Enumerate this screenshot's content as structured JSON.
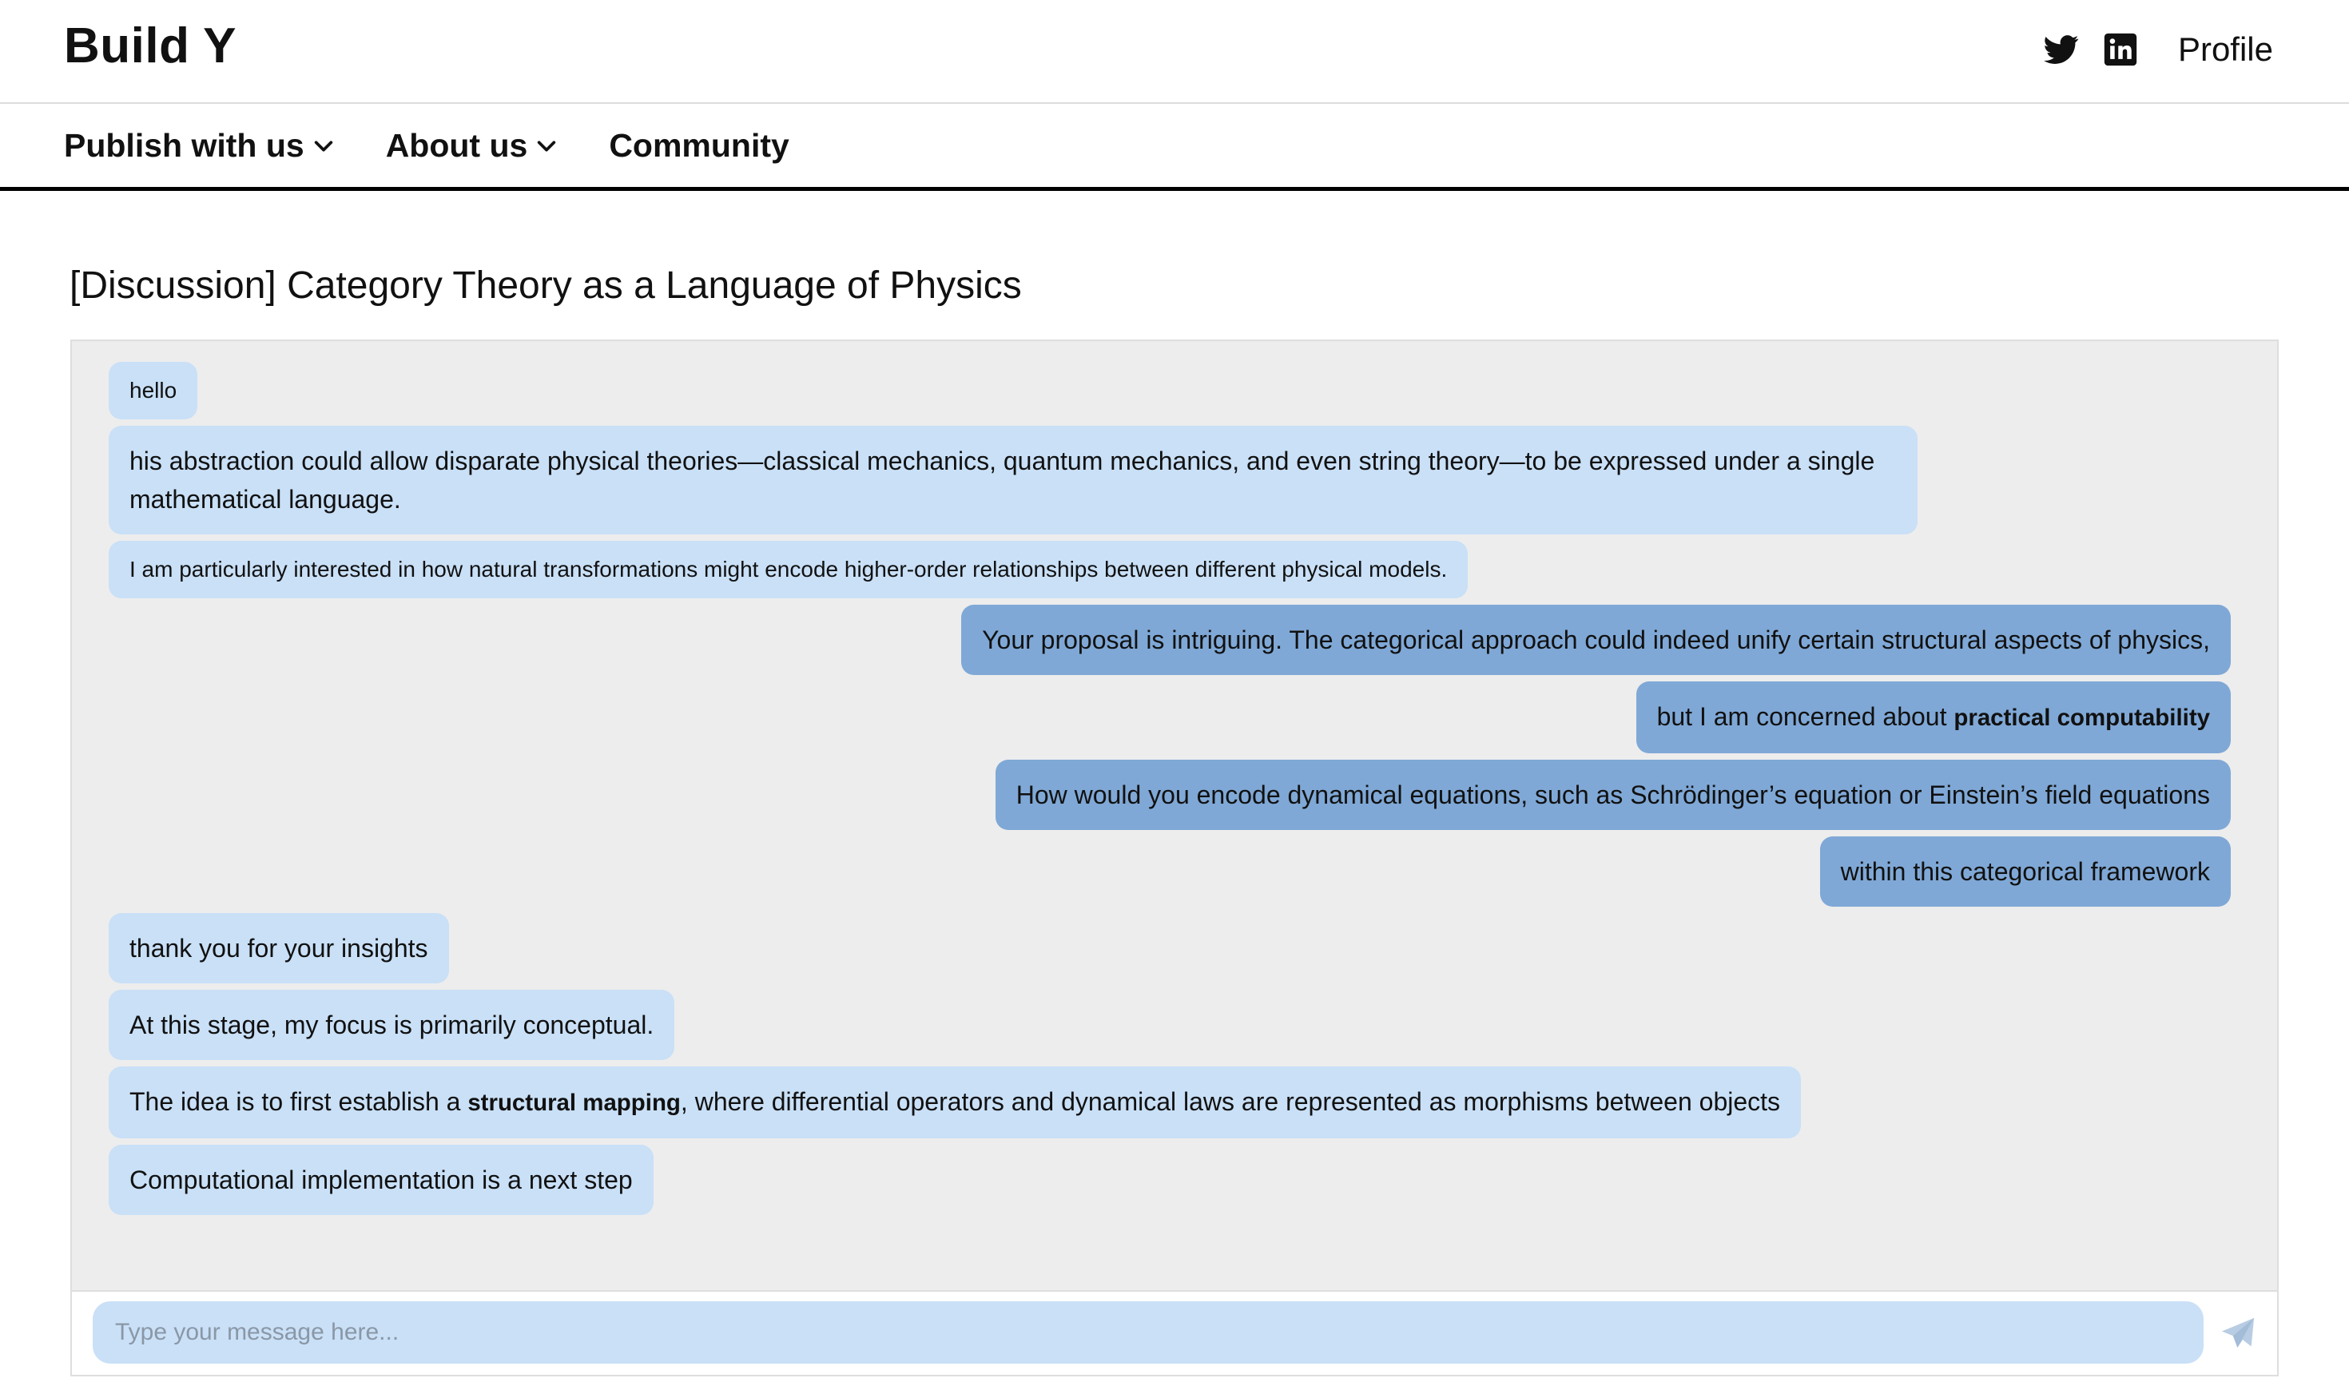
{
  "header": {
    "brand": "Build Y",
    "profile_label": "Profile",
    "icons": [
      "twitter-icon",
      "linkedin-icon"
    ]
  },
  "nav": {
    "items": [
      {
        "label": "Publish with us",
        "has_dropdown": true
      },
      {
        "label": "About us",
        "has_dropdown": true
      },
      {
        "label": "Community",
        "has_dropdown": false
      }
    ]
  },
  "page": {
    "title": "[Discussion] Category Theory as a Language of Physics"
  },
  "chat": {
    "messages": [
      {
        "side": "in",
        "text": "hello"
      },
      {
        "side": "in",
        "text": "his abstraction could allow disparate physical theories—classical mechanics, quantum mechanics, and even string theory—to be expressed under a single mathematical language."
      },
      {
        "side": "in",
        "text": "I am particularly interested in how natural transformations might encode higher-order relationships between different physical models."
      },
      {
        "side": "out",
        "text": "Your proposal is intriguing. The categorical approach could indeed unify certain structural aspects of physics,"
      },
      {
        "side": "out",
        "text_before": "but I am concerned about ",
        "bold": "practical computability",
        "text_after": ""
      },
      {
        "side": "out",
        "text": "How would you encode dynamical equations, such as Schrödinger’s equation or Einstein’s field equations"
      },
      {
        "side": "out",
        "text": "within this categorical framework"
      },
      {
        "side": "in",
        "text": "thank you for your insights"
      },
      {
        "side": "in",
        "text": "At this stage, my focus is primarily conceptual."
      },
      {
        "side": "in",
        "text_before": "The idea is to first establish a ",
        "bold": "structural mapping",
        "text_after": ", where differential operators and dynamical laws are represented as morphisms between objects"
      },
      {
        "side": "in",
        "text": "Computational implementation is a next step"
      }
    ],
    "input_placeholder": "Type your message here...",
    "input_value": ""
  },
  "colors": {
    "incoming_bubble": "#c9e0f7",
    "outgoing_bubble": "#7fa8d6",
    "panel_bg": "#ededed",
    "nav_border": "#000000"
  }
}
